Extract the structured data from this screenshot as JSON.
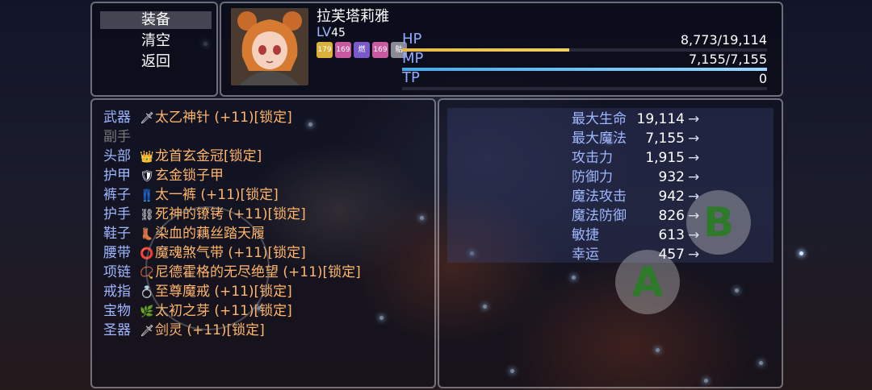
{
  "command": {
    "items": [
      "装备",
      "清空",
      "返回"
    ]
  },
  "actor": {
    "name": "拉芙塔莉雅",
    "level_label": "LV",
    "level": "45",
    "states": [
      {
        "text": "179",
        "color": "#d8b23a"
      },
      {
        "text": "169",
        "color": "#c95aa0"
      },
      {
        "text": "燃",
        "color": "#7a5ac9"
      },
      {
        "text": "169",
        "color": "#c95aa0"
      },
      {
        "text": "骷",
        "color": "#8a8a96"
      }
    ],
    "hp_label": "HP",
    "hp_value": "8,773/19,114",
    "hp_ratio": 0.459,
    "mp_label": "MP",
    "mp_value": "7,155/7,155",
    "mp_ratio": 1.0,
    "tp_label": "TP",
    "tp_value": "0",
    "tp_ratio": 0
  },
  "equip_slots": [
    {
      "type": "武器",
      "icon": "🗡",
      "item": "太乙神针 (+11)[锁定]"
    },
    {
      "type": "副手",
      "icon": "",
      "item": ""
    },
    {
      "type": "头部",
      "icon": "👑",
      "item": "龙首玄金冠[锁定]"
    },
    {
      "type": "护甲",
      "icon": "🛡",
      "item": "玄金锁子甲"
    },
    {
      "type": "裤子",
      "icon": "👖",
      "item": "太一裤 (+11)[锁定]"
    },
    {
      "type": "护手",
      "icon": "⛓",
      "item": "死神的镣铐 (+11)[锁定]"
    },
    {
      "type": "鞋子",
      "icon": "👢",
      "item": "染血的藕丝踏天履"
    },
    {
      "type": "腰带",
      "icon": "⭕",
      "item": "魔魂煞气带 (+11)[锁定]"
    },
    {
      "type": "项链",
      "icon": "📿",
      "item": "尼德霍格的无尽绝望 (+11)[锁定]"
    },
    {
      "type": "戒指",
      "icon": "💍",
      "item": "至尊魔戒 (+11)[锁定]"
    },
    {
      "type": "宝物",
      "icon": "🌿",
      "item": "太初之芽 (+11)[锁定]"
    },
    {
      "type": "圣器",
      "icon": "🗡",
      "item": "剑灵 (+11)[锁定]"
    }
  ],
  "stats": [
    {
      "label": "最大生命",
      "value": "19,114"
    },
    {
      "label": "最大魔法",
      "value": "7,155"
    },
    {
      "label": "攻击力",
      "value": "1,915"
    },
    {
      "label": "防御力",
      "value": "932"
    },
    {
      "label": "魔法攻击",
      "value": "942"
    },
    {
      "label": "魔法防御",
      "value": "826"
    },
    {
      "label": "敏捷",
      "value": "613"
    },
    {
      "label": "幸运",
      "value": "457"
    }
  ],
  "stat_arrow": "→",
  "buttons": {
    "a": "A",
    "b": "B"
  },
  "colors": {
    "hp": "#e8b84a",
    "mp": "#4aa8e8",
    "tp": "#5ad86a",
    "label": "#9fb7ff",
    "item": "#ffb56a"
  }
}
